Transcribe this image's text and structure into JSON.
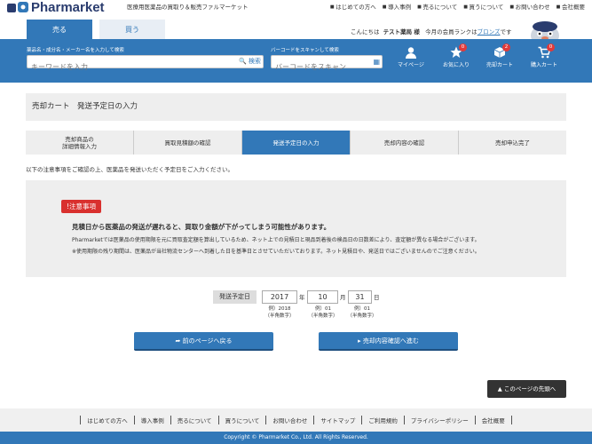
{
  "header": {
    "brand": "Pharmarket",
    "tagline": "医療用医薬品の買取り＆販売ファルマーケット",
    "links": [
      "はじめての方へ",
      "導入事例",
      "売るについて",
      "買うについて",
      "お問い合わせ",
      "会社概要"
    ]
  },
  "tabs": {
    "sell": "売る",
    "buy": "買う"
  },
  "greeting": {
    "prefix": "こんにちは",
    "name": "テスト薬局 様",
    "rank_text": "今月の会員ランクは",
    "rank": "ブロンズ",
    "suffix": "です"
  },
  "search": {
    "keyword_label": "薬品名・成分名・メーカー名を入力して検索",
    "keyword_placeholder": "キーワードを入力",
    "search_button": "検索",
    "barcode_label": "バーコードをスキャンして検索",
    "barcode_placeholder": "バーコードをスキャン"
  },
  "header_icons": {
    "mypage": "マイページ",
    "favorites": "お気に入り",
    "favorites_count": "0",
    "sell_cart": "売却カート",
    "sell_cart_count": "2",
    "buy_cart": "購入カート",
    "buy_cart_count": "0"
  },
  "page_title": "売却カート　発送予定日の入力",
  "steps": [
    "売却商品の\n詳細情報入力",
    "買取見積額の確認",
    "発送予定日の入力",
    "売却内容の確認",
    "売却申込完了"
  ],
  "instruction": "以下の注意事項をご確認の上、医薬品を発送いただく予定日をご入力ください。",
  "notice": {
    "badge": "注意事項",
    "heading": "見積日から医薬品の発送が遅れると、買取り金額が下がってしまう可能性があります。",
    "line1": "Pharmarketでは医薬品の使用期限を元に買取査定額を算出しているため、ネット上での見積日と現品到着後の検品日の日数差により、査定額が異なる場合がございます。",
    "line2": "※使用期限の残り期間は、医薬品が当社物流センターへ到着した日を基準日とさせていただいております。ネット見積日や、発送日ではございませんのでご注意ください。"
  },
  "date_form": {
    "label": "発送予定日",
    "year": "2017",
    "year_unit": "年",
    "month": "10",
    "month_unit": "月",
    "day": "31",
    "day_unit": "日",
    "year_example": "例）2018\n（半角数字）",
    "month_example": "例）01\n（半角数字）",
    "day_example": "例）01\n（半角数字）"
  },
  "buttons": {
    "back": "前のページへ戻る",
    "next": "売却内容確認へ進む"
  },
  "to_top": "このページの先頭へ",
  "footer_links": [
    "はじめての方へ",
    "導入事例",
    "売るについて",
    "買うについて",
    "お問い合わせ",
    "サイトマップ",
    "ご利用規約",
    "プライバシーポリシー",
    "会社概要"
  ],
  "copyright": "Copyright © Pharmarket Co., Ltd. All Rights Reserved.",
  "colors": {
    "primary": "#3278b8",
    "alert": "#d9302e",
    "badge": "#e03a3a"
  }
}
